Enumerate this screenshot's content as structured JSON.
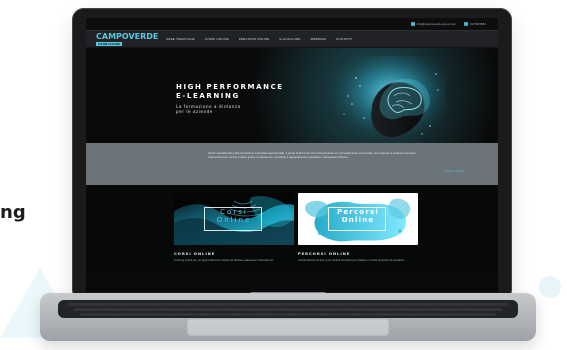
{
  "page": {
    "left_fragment": "ng"
  },
  "site": {
    "contacts": {
      "email": "info@campoverde-group.com",
      "phone": "02 5815581"
    },
    "logo": {
      "text": "CAMPOVERDE",
      "subtext": "FORMAZIONE"
    },
    "nav": {
      "items": [
        "AREE TEMATICHE",
        "CORSI ONLINE",
        "PERCORSI ONLINE",
        "E-COACHING",
        "WEBINAR",
        "CONTATTI"
      ]
    },
    "hero": {
      "title_line1": "HIGH PERFORMANCE",
      "title_line2": "E-LEARNING",
      "subtitle_line1": "La formazione a distanza",
      "subtitle_line2": "per le aziende"
    },
    "intro": {
      "text": "Ventis specializzate nella formazione aziendale esperienziale, il punto di forza dei corsi Campoverde è il coinvolgimento emozionale, che mescola a contenuti formativi l’apprendimento. Anche l’online grazie a piattaforme, contributi e apprendimento interattivo, interessanti efficace.",
      "link": "Scopri di più"
    },
    "cards": [
      {
        "image_title_line1": "Corsi",
        "image_title_line2": "Online",
        "title": "Corsi Online",
        "desc": "Training online per un apprendimento rapido ed efficace attraverso l’interazione."
      },
      {
        "image_title_line1": "Percorsi",
        "image_title_line2": "Online",
        "title": "Percorsi Online",
        "desc": "Combinazione di due o più moduli formativi per trattare in modo completo la tematica."
      }
    ],
    "colors": {
      "accent": "#59c7df",
      "nav_bg": "#202226",
      "intro_bg": "#6b7479",
      "background": "#ffffff"
    }
  }
}
